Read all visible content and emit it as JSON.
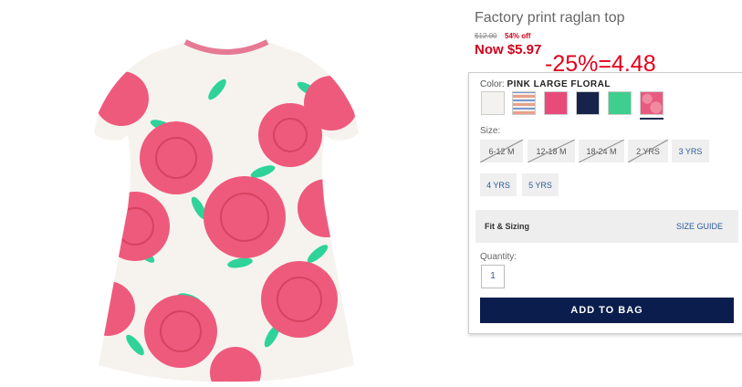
{
  "product": {
    "title": "Factory print raglan top",
    "original_price": "$12.00",
    "discount": "54% off",
    "now_price": "Now $5.97"
  },
  "annotation": "-25%=4.48",
  "color": {
    "label": "Color:",
    "selected": "PINK LARGE FLORAL",
    "swatches": [
      {
        "name": "white",
        "color": "#f4f2ee"
      },
      {
        "name": "stripe",
        "color": "#e8a089"
      },
      {
        "name": "pink",
        "color": "#e84a7a"
      },
      {
        "name": "navy",
        "color": "#17234a"
      },
      {
        "name": "green",
        "color": "#3ecf8e"
      },
      {
        "name": "pink-floral",
        "color": "#e85a80"
      }
    ]
  },
  "size": {
    "label": "Size:",
    "options": [
      {
        "label": "6-12 M",
        "available": false
      },
      {
        "label": "12-18 M",
        "available": false
      },
      {
        "label": "18-24 M",
        "available": false
      },
      {
        "label": "2 YRS",
        "available": false
      },
      {
        "label": "3 YRS",
        "available": true
      },
      {
        "label": "4 YRS",
        "available": true
      },
      {
        "label": "5 YRS",
        "available": true
      }
    ]
  },
  "fit": {
    "label": "Fit & Sizing",
    "guide": "SIZE GUIDE"
  },
  "quantity": {
    "label": "Quantity:",
    "value": "1"
  },
  "add_to_bag": "ADD TO BAG"
}
